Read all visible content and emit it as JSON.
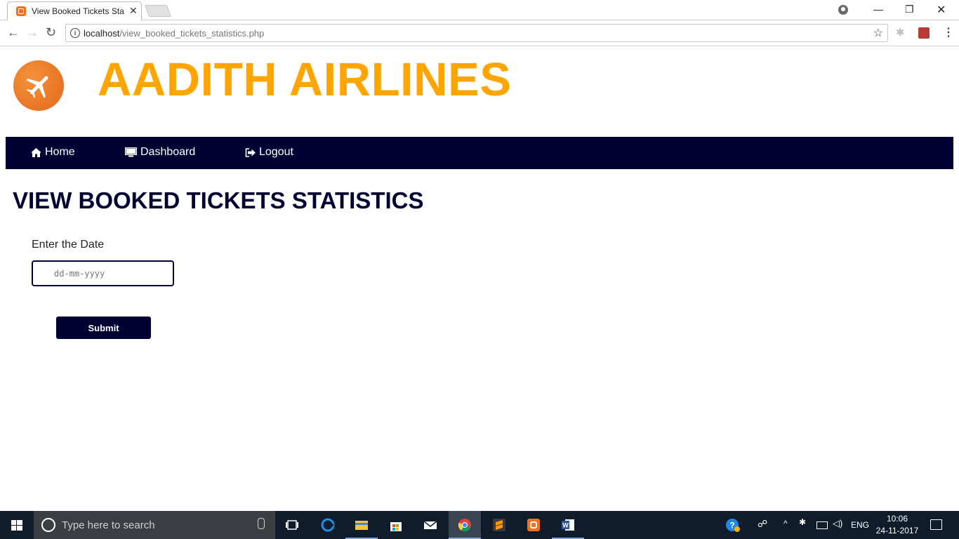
{
  "browser": {
    "tab_title": "View Booked Tickets Stat",
    "url_host": "localhost",
    "url_path": "/view_booked_tickets_statistics.php"
  },
  "brand": {
    "name": "AADITH AIRLINES",
    "color": "#ffa500"
  },
  "navbar": {
    "background": "#000033",
    "items": [
      {
        "label": "Home",
        "icon": "home-icon"
      },
      {
        "label": "Dashboard",
        "icon": "monitor-icon"
      },
      {
        "label": "Logout",
        "icon": "logout-icon"
      }
    ]
  },
  "main": {
    "title": "VIEW BOOKED TICKETS STATISTICS",
    "date_label": "Enter the Date",
    "date_placeholder": "dd-mm-yyyy",
    "submit_label": "Submit"
  },
  "taskbar": {
    "search_placeholder": "Type here to search",
    "language": "ENG",
    "time": "10:06",
    "date": "24-11-2017",
    "apps": [
      "task-view",
      "edge",
      "file-explorer",
      "store",
      "mail",
      "chrome",
      "sublime-text",
      "xampp",
      "word"
    ],
    "active_app": "chrome"
  }
}
